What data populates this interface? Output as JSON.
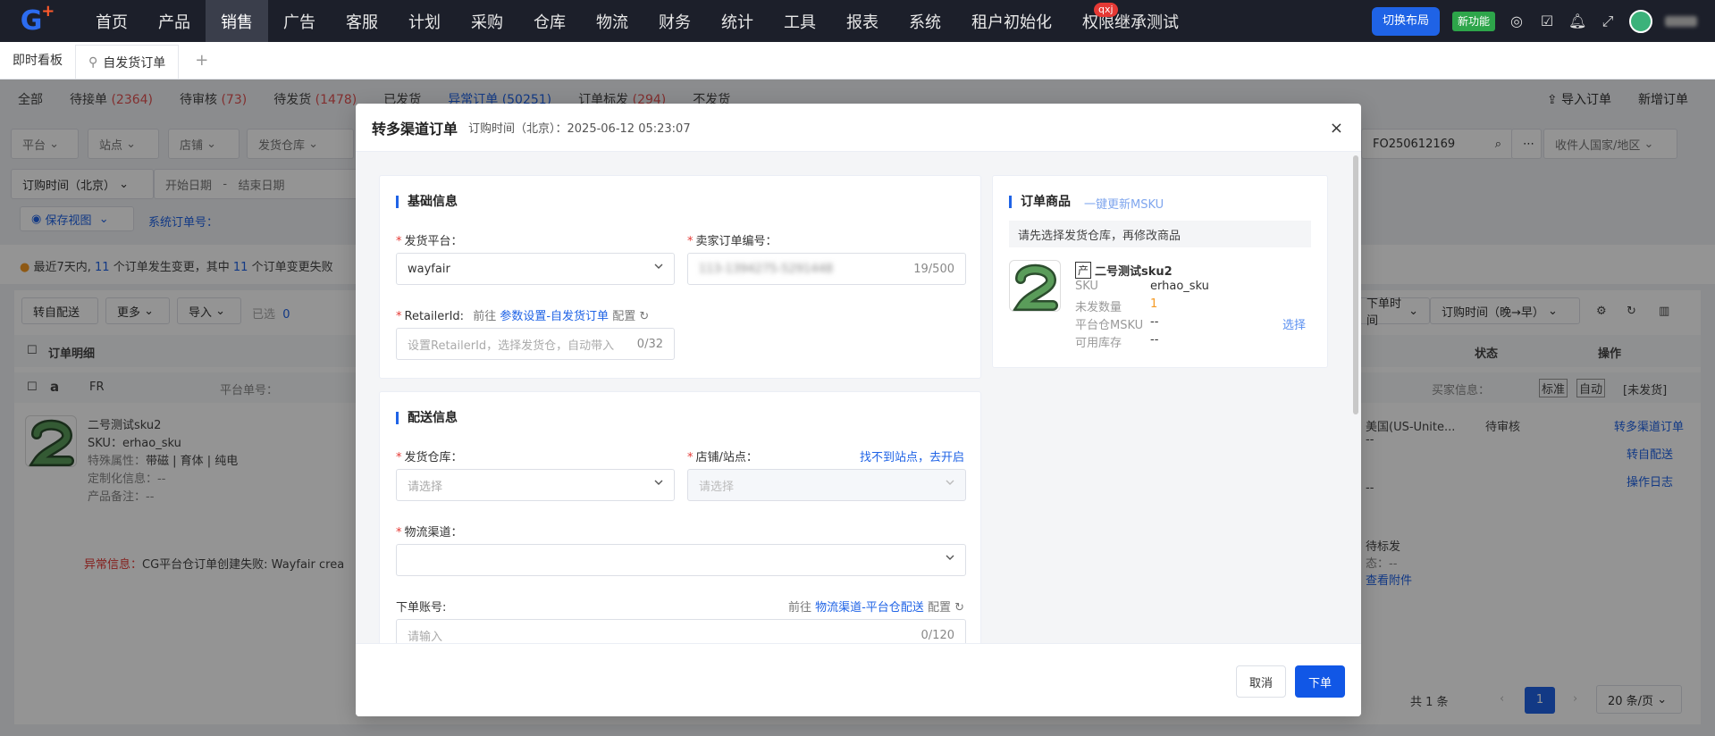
{
  "nav": {
    "items": [
      "首页",
      "产品",
      "销售",
      "广告",
      "客服",
      "计划",
      "采购",
      "仓库",
      "物流",
      "财务",
      "统计",
      "工具",
      "报表",
      "系统",
      "租户初始化",
      "权限继承测试"
    ],
    "active_index": 2,
    "badge_text": "qxj",
    "switch_layout": "切换布局",
    "new_feature": "新功能"
  },
  "tabs": {
    "dashboard": "即时看板",
    "active": "自发货订单",
    "add": "+"
  },
  "bg": {
    "status": [
      {
        "label": "全部",
        "count": ""
      },
      {
        "label": "待接单",
        "count": "(2364)"
      },
      {
        "label": "待审核",
        "count": "(73)"
      },
      {
        "label": "待发货",
        "count": "(1478)"
      },
      {
        "label": "已发货",
        "count": ""
      },
      {
        "label": "异常订单",
        "count": "(50251)"
      },
      {
        "label": "订单标发",
        "count": "(294)"
      },
      {
        "label": "不发货",
        "count": ""
      }
    ],
    "import_order": "导入订单",
    "new_order": "新增订单",
    "filters": [
      "平台",
      "站点",
      "店铺",
      "发货仓库"
    ],
    "search_value": "FO250612169",
    "receiver_country": "收件人国家/地区",
    "order_time": "订购时间（北京）",
    "start_date": "开始日期",
    "end_date": "结束日期",
    "save_view": "保存视图",
    "system_order_no": "系统订单号：",
    "notice_prefix": "最近7天内,",
    "notice_n1": "11",
    "notice_mid": "个订单发生变更，其中",
    "notice_n2": "11",
    "notice_suffix": "个订单变更失败",
    "btn_transfer": "转自配送",
    "btn_more": "更多",
    "btn_import": "导入",
    "selected_label": "已选",
    "selected_count": "0",
    "sort_time": "订购时间（晚→早）",
    "sort_label": "下单时间",
    "col_detail": "订单明细",
    "col_status": "状态",
    "col_action": "操作",
    "row_site": "FR",
    "row_platform_no": "平台单号：",
    "row_sku_name": "二号测试sku2",
    "row_sku": "SKU：erhao_sku",
    "row_attr_label": "特殊属性：",
    "row_attr_val": "带磁 | 育体 | 纯电",
    "row_custom": "定制化信息：--",
    "row_remark": "产品备注：--",
    "row_country": "美国(US-Unite...",
    "row_status": "待审核",
    "row_actions": [
      "转多渠道订单",
      "转自配送",
      "操作日志"
    ],
    "buyer_info": "买家信息：",
    "tag_std": "标准",
    "tag_auto": "自动",
    "tag_unshipped": "[未发货]",
    "error_label": "异常信息：",
    "error_text": "CG平台仓订单创建失败: Wayfair crea",
    "side_dash1": "--",
    "side_dash2": "--",
    "side_mark": "待标发",
    "side_state": "态：--",
    "side_attach": "查看附件",
    "total": "共 1 条",
    "page": "1",
    "page_size": "20 条/页"
  },
  "modal": {
    "title": "转多渠道订单",
    "order_time": "订购时间（北京）：2025-06-12 05:23:07",
    "close": "×",
    "basic": {
      "title": "基础信息",
      "platform_label": "发货平台：",
      "platform_value": "wayfair",
      "seller_no_label": "卖家订单编号：",
      "seller_no_value": "113-1394275-5291448",
      "seller_no_count": "19/500",
      "retailer_label": "RetailerId:",
      "retailer_hint_prefix": "前往",
      "retailer_hint_link": "参数设置-自发货订单",
      "retailer_hint_suffix": "配置",
      "retailer_placeholder": "设置RetailerId，选择发货仓，自动带入",
      "retailer_count": "0/32"
    },
    "shipping": {
      "title": "配送信息",
      "warehouse_label": "发货仓库：",
      "warehouse_placeholder": "请选择",
      "store_label": "店铺/站点：",
      "store_link": "找不到站点，去开启",
      "store_placeholder": "请选择",
      "channel_label": "物流渠道：",
      "account_label": "下单账号:",
      "account_hint_prefix": "前往",
      "account_hint_link": "物流渠道-平台仓配送",
      "account_hint_suffix": "配置",
      "account_placeholder": "请输入",
      "account_count": "0/120"
    },
    "goods": {
      "title": "订单商品",
      "update_link": "一键更新MSKU",
      "tip": "请先选择发货仓库，再修改商品",
      "tag": "产",
      "name": "二号测试sku2",
      "sku_label": "SKU",
      "sku_value": "erhao_sku",
      "qty_label": "未发数量",
      "qty_value": "1",
      "msku_label": "平台仓MSKU",
      "msku_value": "--",
      "select": "选择",
      "stock_label": "可用库存",
      "stock_value": "--"
    },
    "cancel": "取消",
    "submit": "下单"
  },
  "colors": {
    "accent": "#1157e6",
    "required": "#e53935",
    "nav_bg": "#1c1f2a",
    "new_feature": "#2da54a"
  }
}
